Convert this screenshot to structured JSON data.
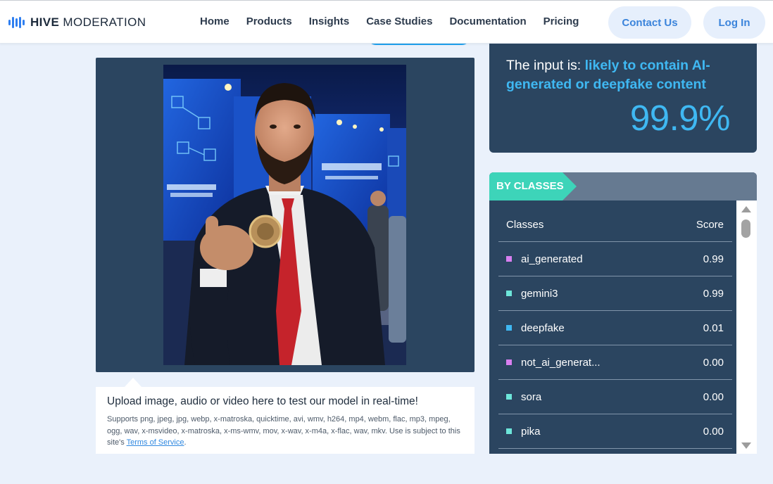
{
  "header": {
    "logo_bold": "HIVE",
    "logo_light": "MODERATION",
    "nav": [
      "Home",
      "Products",
      "Insights",
      "Case Studies",
      "Documentation",
      "Pricing"
    ],
    "contact_label": "Contact Us",
    "login_label": "Log In"
  },
  "upload": {
    "title": "Upload image, audio or video here to test our model in real-time!",
    "desc_prefix": "Supports png, jpeg, jpg, webp, x-matroska, quicktime, avi, wmv, h264, mp4, webm, flac, mp3, mpeg, ogg, wav, x-msvideo, x-matroska, x-ms-wmv, mov, x-wav, x-m4a, x-flac, wav, mkv. Use is subject to this site's ",
    "tos_link": "Terms of Service",
    "desc_suffix": "."
  },
  "result": {
    "prefix": "The input is: ",
    "verdict": "likely to contain AI-generated or deepfake content",
    "score": "99.9%"
  },
  "classes": {
    "tag": "BY CLASSES",
    "col_class": "Classes",
    "col_score": "Score",
    "rows": [
      {
        "name": "ai_generated",
        "score": "0.99",
        "color": "#d87ff0"
      },
      {
        "name": "gemini3",
        "score": "0.99",
        "color": "#6de6da"
      },
      {
        "name": "deepfake",
        "score": "0.01",
        "color": "#3fb8f2"
      },
      {
        "name": "not_ai_generat...",
        "score": "0.00",
        "color": "#d87ff0"
      },
      {
        "name": "sora",
        "score": "0.00",
        "color": "#6de6da"
      },
      {
        "name": "pika",
        "score": "0.00",
        "color": "#6de6da"
      }
    ]
  },
  "colors": {
    "panel": "#2b4560",
    "accent": "#3fb8f2",
    "tag": "#3dd4b9",
    "page_bg": "#eaf1fb"
  }
}
